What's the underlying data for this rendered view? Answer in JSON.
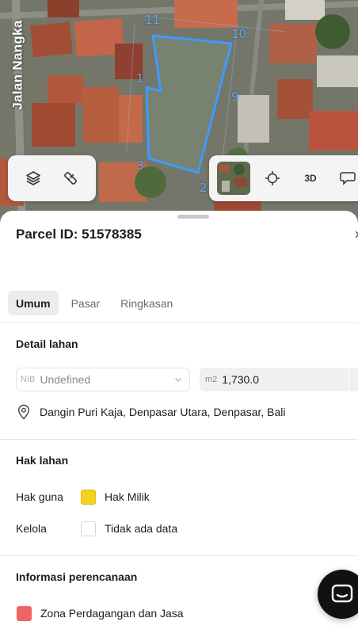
{
  "map": {
    "street_label": "Jalan Nangka",
    "parcel_numbers": [
      "11",
      "10",
      "1",
      "9",
      "3",
      "2"
    ],
    "parcel_outline_color": "#3d9bff",
    "controls_left": [
      {
        "icon": "layers-icon"
      },
      {
        "icon": "ruler-icon"
      }
    ],
    "controls_right": [
      {
        "icon": "satellite-thumbnail"
      },
      {
        "icon": "crosshair-icon"
      },
      {
        "label": "3D"
      },
      {
        "icon": "chat-bubble-icon"
      }
    ]
  },
  "sheet": {
    "title": "Parcel ID: 51578385",
    "tabs": [
      {
        "label": "Umum",
        "active": true
      },
      {
        "label": "Pasar",
        "active": false
      },
      {
        "label": "Ringkasan",
        "active": false
      }
    ],
    "detail": {
      "heading": "Detail lahan",
      "nib_prefix": "NIB",
      "nib_value": "Undefined",
      "area_unit": "m2",
      "area_value": "1,730.0",
      "address": "Dangin Puri Kaja, Denpasar Utara, Denpasar, Bali"
    },
    "rights": {
      "heading": "Hak lahan",
      "rows": [
        {
          "label": "Hak guna",
          "value": "Hak Milik",
          "color": "#f5d21f"
        },
        {
          "label": "Kelola",
          "value": "Tidak ada data",
          "color": "#ffffff"
        }
      ]
    },
    "planning": {
      "heading": "Informasi perencanaan",
      "zone": "Zona Perdagangan dan Jasa",
      "zone_color": "#ef6464"
    }
  }
}
